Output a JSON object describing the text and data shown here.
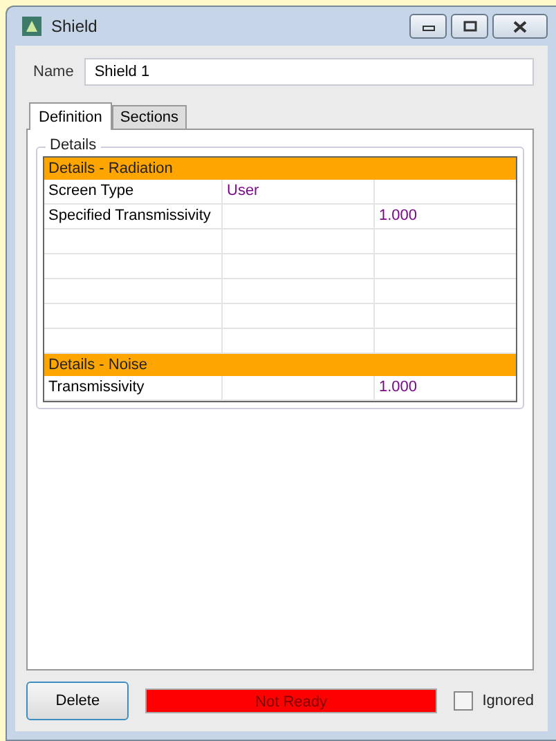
{
  "window": {
    "title": "Shield"
  },
  "name_field": {
    "label": "Name",
    "value": "Shield 1"
  },
  "tabs": [
    {
      "label": "Definition",
      "selected": true
    },
    {
      "label": "Sections",
      "selected": false
    }
  ],
  "details": {
    "title": "Details",
    "rows": [
      {
        "kind": "header",
        "cells": [
          "Details - Radiation"
        ]
      },
      {
        "kind": "row",
        "cells": [
          "Screen Type",
          "User",
          ""
        ]
      },
      {
        "kind": "row",
        "cells": [
          "Specified Transmissivity",
          "",
          "1.000"
        ]
      },
      {
        "kind": "blank"
      },
      {
        "kind": "blank"
      },
      {
        "kind": "blank"
      },
      {
        "kind": "blank"
      },
      {
        "kind": "blank"
      },
      {
        "kind": "header",
        "cells": [
          "Details - Noise"
        ]
      },
      {
        "kind": "row",
        "cells": [
          "Transmissivity",
          "",
          "1.000"
        ]
      }
    ]
  },
  "delete_button": "Delete",
  "status": {
    "text": "Not Ready",
    "color": "#ff0000"
  },
  "ignored": {
    "label": "Ignored",
    "checked": false
  }
}
